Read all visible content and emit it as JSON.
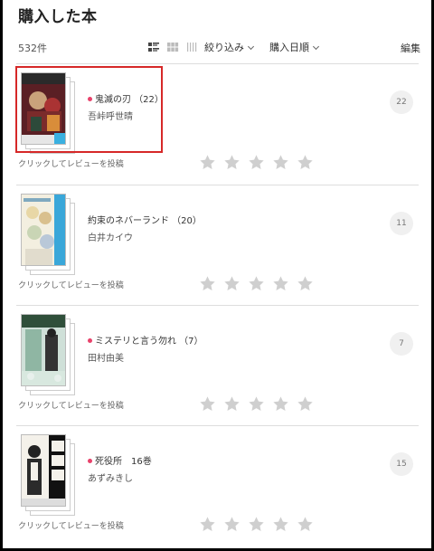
{
  "header": {
    "title": "購入した本"
  },
  "toolbar": {
    "count": "532件",
    "filter_label": "絞り込み",
    "sort_label": "購入日順",
    "edit_label": "編集"
  },
  "books": [
    {
      "title": "鬼滅の刃 （22）",
      "author": "吾峠呼世晴",
      "badge": "22",
      "review_label": "クリックしてレビューを投稿",
      "is_new": true
    },
    {
      "title": "約束のネバーランド （20）",
      "author": "白井カイウ",
      "badge": "11",
      "review_label": "クリックしてレビューを投稿",
      "is_new": false
    },
    {
      "title": "ミステリと言う勿れ （7）",
      "author": "田村由美",
      "badge": "7",
      "review_label": "クリックしてレビューを投稿",
      "is_new": true
    },
    {
      "title": "死役所　16巻",
      "author": "あずみきし",
      "badge": "15",
      "review_label": "クリックしてレビューを投稿",
      "is_new": true
    }
  ],
  "colors": {
    "new_dot": "#e8426b",
    "highlight": "#d62828",
    "star": "#cfcfcf"
  }
}
